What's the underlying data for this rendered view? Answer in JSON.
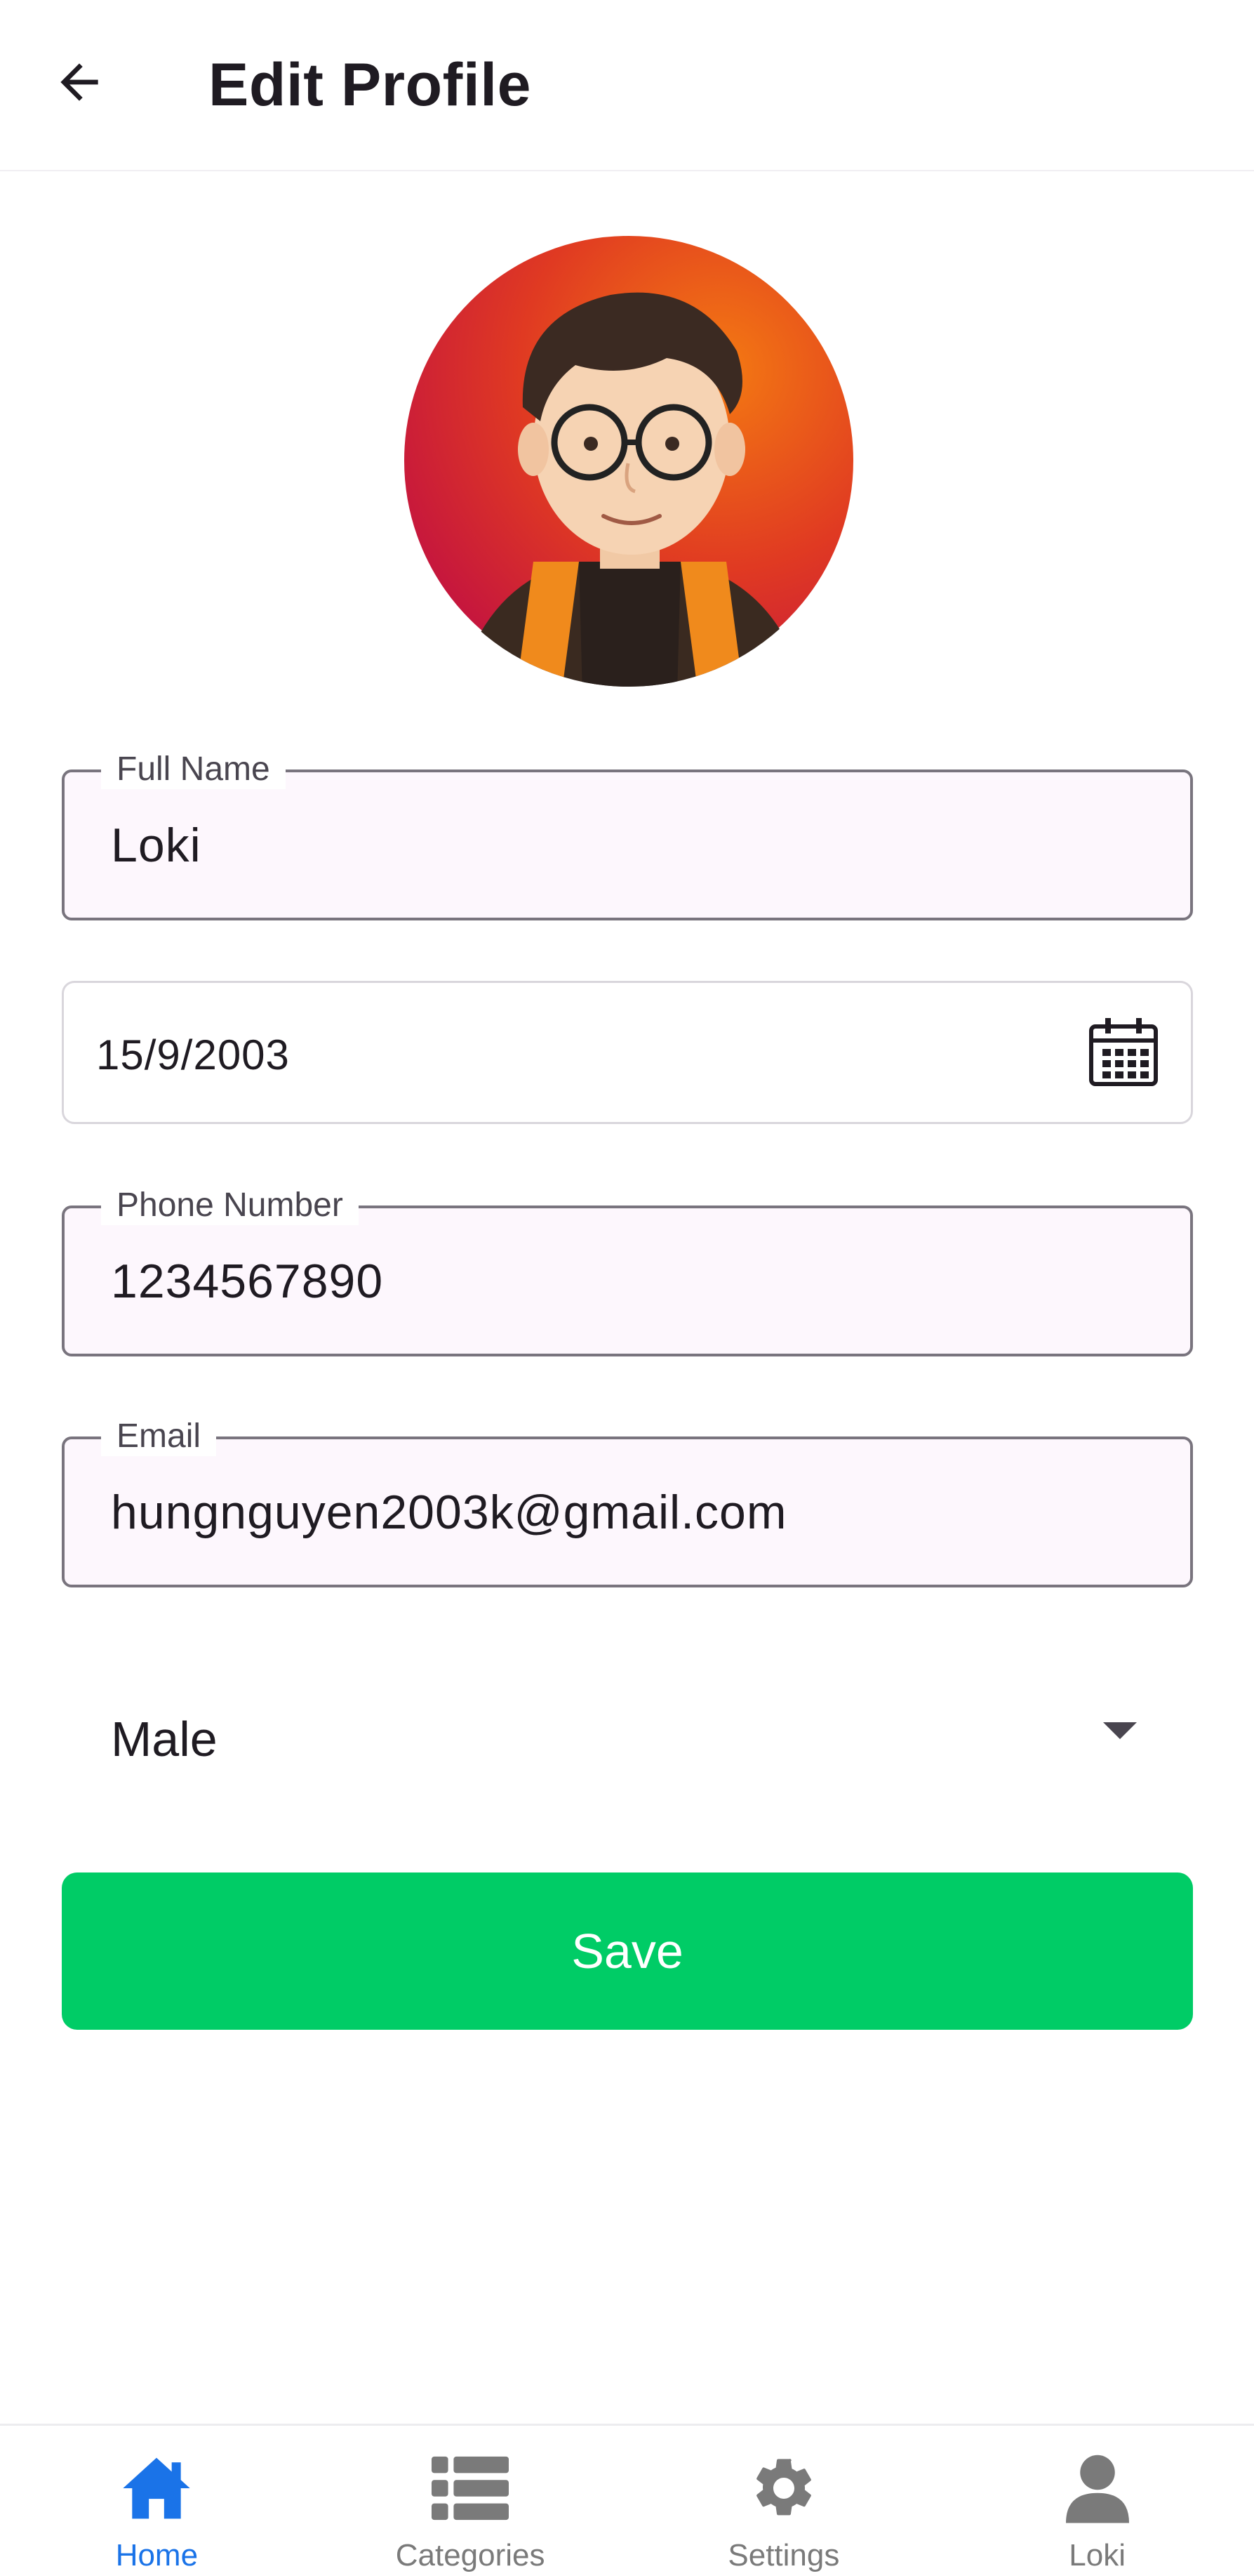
{
  "header": {
    "title": "Edit Profile",
    "back_icon": "arrow-left-icon"
  },
  "avatar": {
    "icon": "avatar-illustration"
  },
  "form": {
    "full_name": {
      "label": "Full Name",
      "value": "Loki"
    },
    "birth_date": {
      "value": "15/9/2003",
      "icon": "calendar-icon"
    },
    "phone": {
      "label": "Phone Number",
      "value": "1234567890"
    },
    "email": {
      "label": "Email",
      "value": "hungnguyen2003k@gmail.com"
    },
    "gender": {
      "value": "Male",
      "icon": "dropdown-arrow-icon"
    },
    "save_label": "Save"
  },
  "colors": {
    "save_button": "#00cc66",
    "nav_active": "#1a73e8",
    "nav_inactive": "#7a7a7a",
    "field_fill": "#fdf7fd",
    "field_border": "#79747e"
  },
  "bottom_nav": {
    "items": [
      {
        "label": "Home",
        "icon": "home-icon",
        "active": true
      },
      {
        "label": "Categories",
        "icon": "list-icon",
        "active": false
      },
      {
        "label": "Settings",
        "icon": "gear-icon",
        "active": false
      },
      {
        "label": "Loki",
        "icon": "user-icon",
        "active": false
      }
    ]
  }
}
